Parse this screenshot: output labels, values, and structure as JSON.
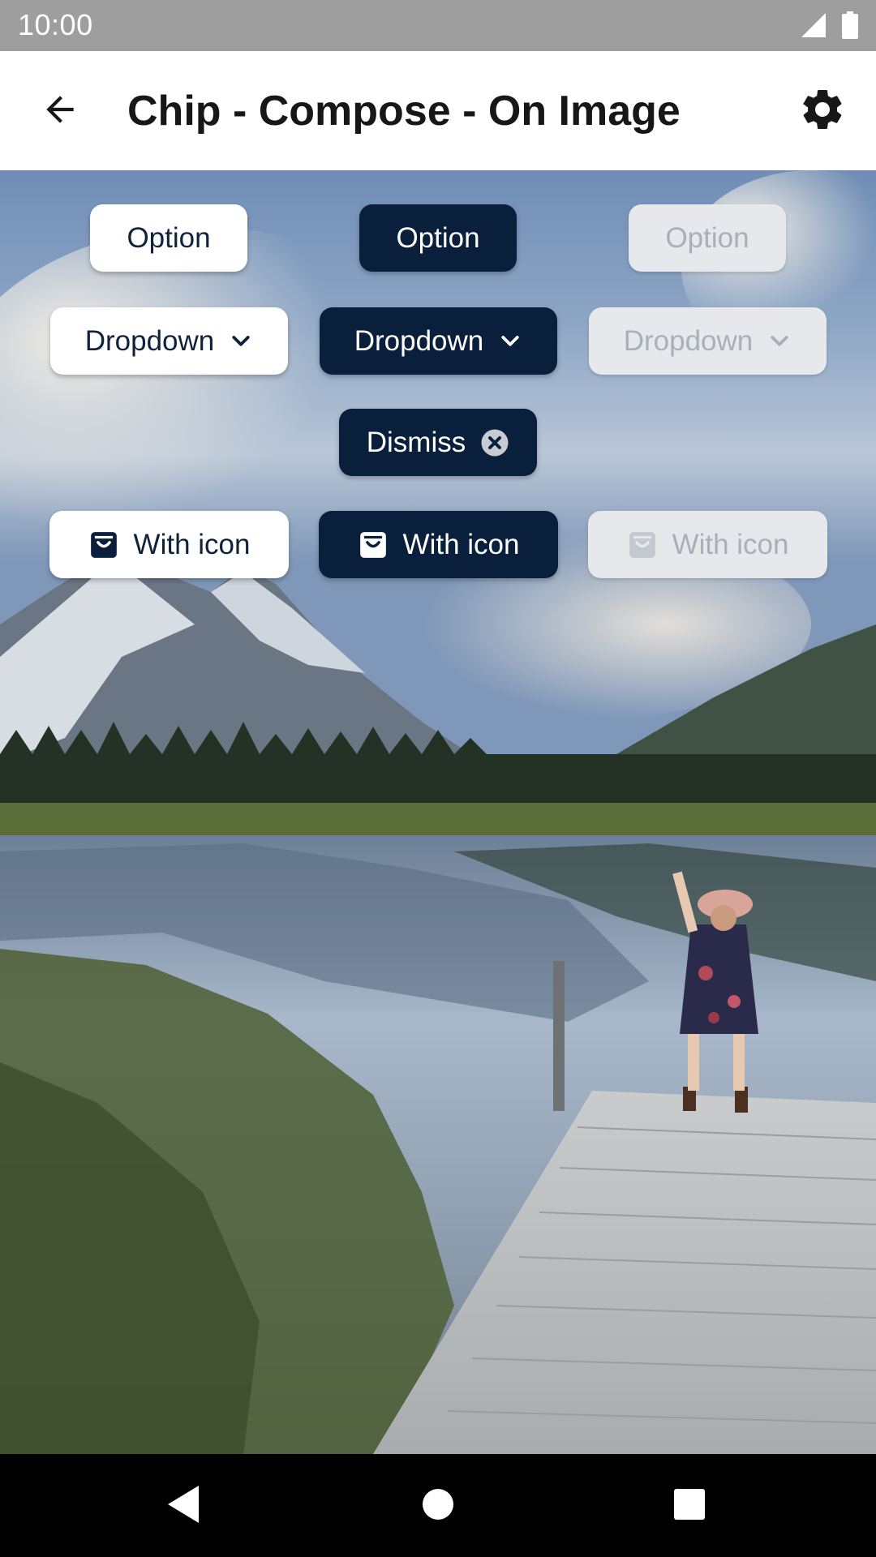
{
  "status_bar": {
    "time": "10:00",
    "icons": [
      "signal-icon",
      "battery-icon"
    ]
  },
  "app_bar": {
    "title": "Chip - Compose - On Image",
    "back_icon": "arrow-back-icon",
    "settings_icon": "gear-icon"
  },
  "chips": {
    "option": [
      "Option",
      "Option",
      "Option"
    ],
    "dropdown": [
      "Dropdown",
      "Dropdown",
      "Dropdown"
    ],
    "dismiss": "Dismiss",
    "with_icon": [
      "With icon",
      "With icon",
      "With icon"
    ]
  },
  "colors": {
    "chip_dark": "#0a1f3c",
    "chip_light": "#ffffff",
    "chip_disabled": "#e6e8eb",
    "status_bar": "#9e9e9e"
  },
  "nav_bar": {
    "icons": [
      "nav-back-icon",
      "nav-home-icon",
      "nav-recents-icon"
    ]
  }
}
